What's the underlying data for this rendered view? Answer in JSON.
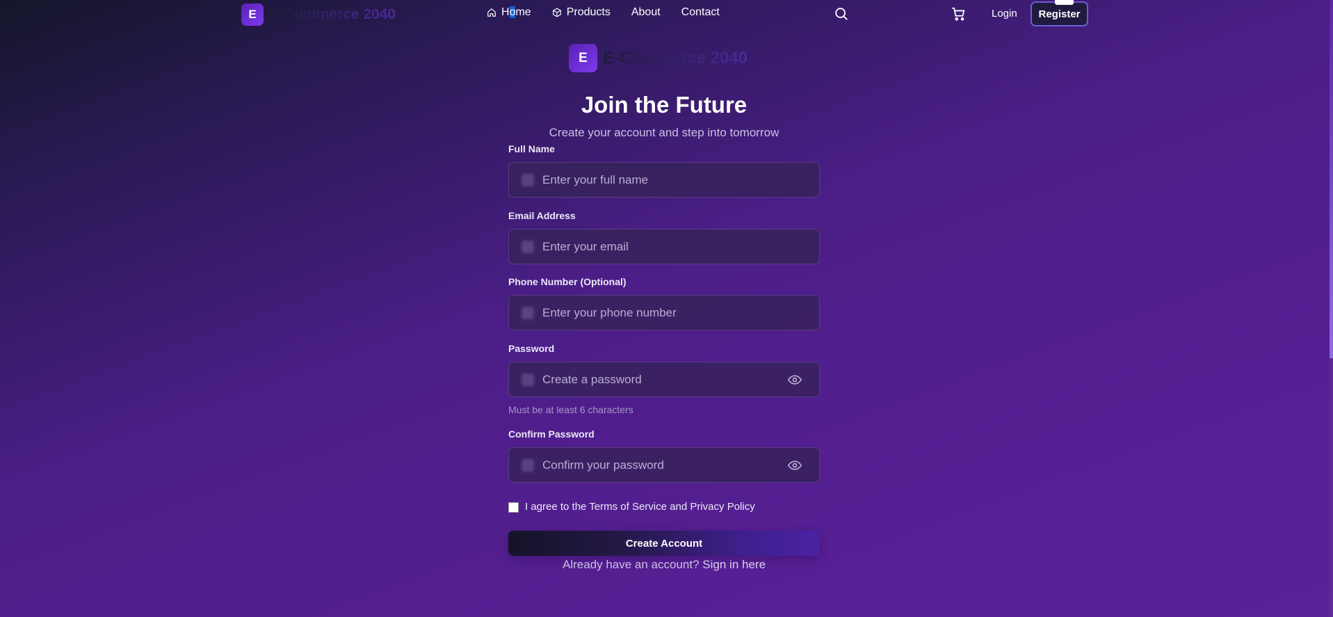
{
  "nav": {
    "brand_badge": "E",
    "brand_name": "E-Commerce 2040",
    "home_first": "H",
    "home_highlight": "o",
    "home_rest": "me",
    "products": "Products",
    "about": "About",
    "contact": "Contact",
    "login": "Login",
    "register": "Register"
  },
  "logo": {
    "badge": "E",
    "name": "E-Commerce 2040"
  },
  "form": {
    "title": "Join the Future",
    "subtitle": "Create your account and step into tomorrow",
    "full_name_label": "Full Name",
    "full_name_placeholder": "Enter your full name",
    "email_label": "Email Address",
    "email_placeholder": "Enter your email",
    "phone_label": "Phone Number (Optional)",
    "phone_placeholder": "Enter your phone number",
    "password_label": "Password",
    "password_placeholder": "Create a password",
    "password_hint": "Must be at least 6 characters",
    "confirm_label": "Confirm Password",
    "confirm_placeholder": "Confirm your password",
    "agree_text": "I agree to the Terms of Service and Privacy Policy",
    "submit": "Create Account",
    "signin_prompt": "Already have an account?",
    "signin_link": "Sign in here"
  },
  "colors": {
    "accent": "#7c3aed",
    "background": "#561f93"
  },
  "icons": [
    "home-icon",
    "box-icon",
    "search-icon",
    "cart-icon",
    "user-icon",
    "mail-icon",
    "phone-icon",
    "lock-icon",
    "eye-icon"
  ]
}
